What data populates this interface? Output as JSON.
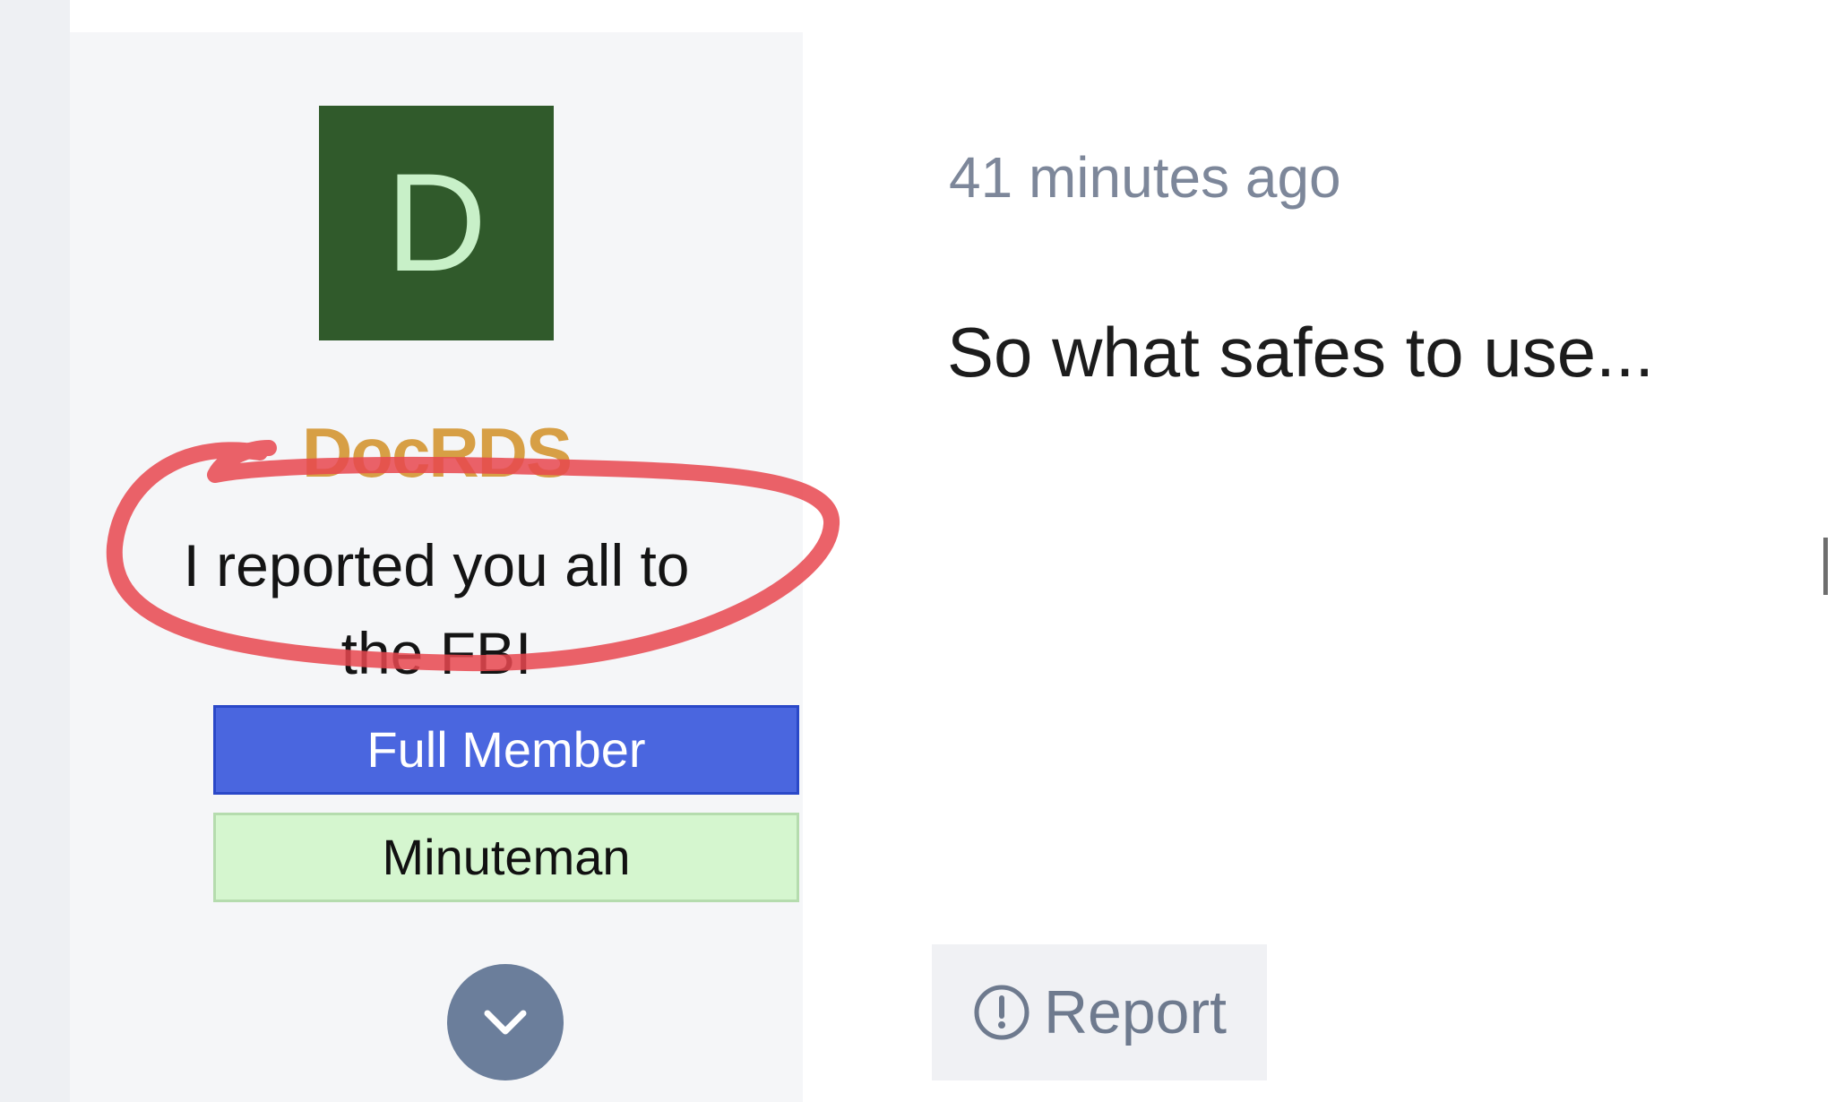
{
  "user": {
    "avatar_letter": "D",
    "username": "DocRDS",
    "custom_title": "I reported you all to the FBI",
    "banners": [
      "Full Member",
      "Minuteman"
    ]
  },
  "post": {
    "timestamp": "41 minutes ago",
    "message": "So what safes to use...",
    "report_label": "Report"
  },
  "colors": {
    "avatar_bg": "#305a2b",
    "username": "#d79f45",
    "full_member_banner": "#4a66df",
    "minuteman_banner": "#d5f6cf",
    "annotation_circle": "#e8464f"
  },
  "icons": {
    "expand": "chevron-down-icon",
    "report": "alert-circle-icon"
  }
}
